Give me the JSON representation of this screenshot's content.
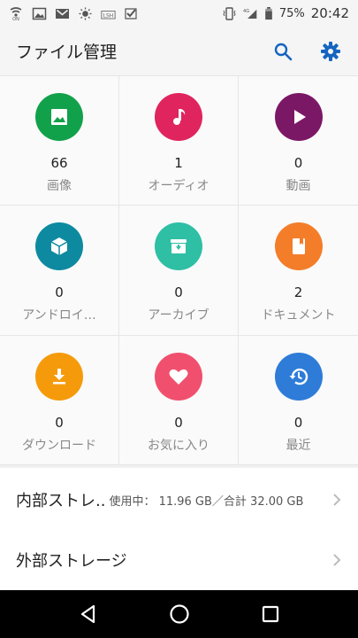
{
  "status_bar": {
    "battery_pct": "75%",
    "time": "20:42",
    "network": "4G",
    "left_icons": [
      "wifi-call-icon",
      "image-icon",
      "gmail-icon",
      "brightness-icon",
      "lsh-icon",
      "check-icon"
    ],
    "right_icons": [
      "vibrate-icon",
      "signal-icon",
      "battery-icon"
    ]
  },
  "app_bar": {
    "title": "ファイル管理",
    "actions": [
      "search-icon",
      "gear-icon"
    ],
    "accent": "#1565c0"
  },
  "categories": [
    {
      "count": "66",
      "label": "画像",
      "color": "#12a14b",
      "icon": "image-icon"
    },
    {
      "count": "1",
      "label": "オーディオ",
      "color": "#e0245e",
      "icon": "music-note-icon"
    },
    {
      "count": "0",
      "label": "動画",
      "color": "#7b1866",
      "icon": "play-icon"
    },
    {
      "count": "0",
      "label": "アンドロイ…",
      "color": "#0d8aa0",
      "icon": "package-icon"
    },
    {
      "count": "0",
      "label": "アーカイブ",
      "color": "#2ebfa5",
      "icon": "archive-icon"
    },
    {
      "count": "2",
      "label": "ドキュメント",
      "color": "#f47d2a",
      "icon": "document-icon"
    },
    {
      "count": "0",
      "label": "ダウンロード",
      "color": "#f59b0b",
      "icon": "download-icon"
    },
    {
      "count": "0",
      "label": "お気に入り",
      "color": "#f0506e",
      "icon": "heart-icon"
    },
    {
      "count": "0",
      "label": "最近",
      "color": "#2e7cd8",
      "icon": "history-icon"
    }
  ],
  "storage": {
    "internal": {
      "title": "内部ストレ..",
      "usage": "使用中： 11.96 GB／合計 32.00 GB"
    },
    "external": {
      "title": "外部ストレージ"
    }
  },
  "nav_bar": [
    "back-icon",
    "home-icon",
    "recents-icon"
  ]
}
